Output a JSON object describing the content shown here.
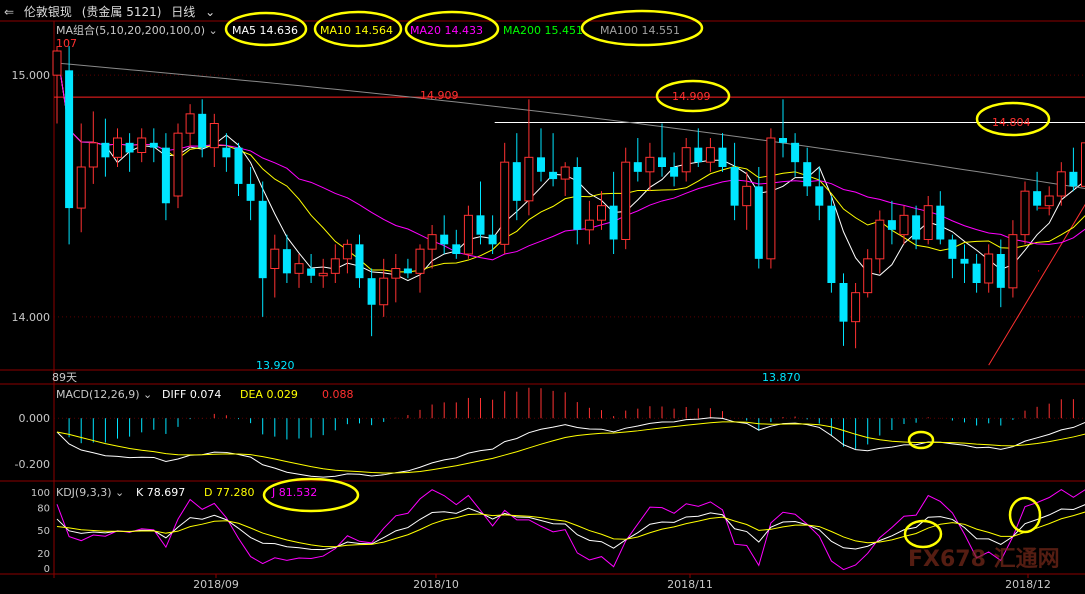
{
  "header": {
    "back_icon": "back-arrows-icon",
    "instrument": "伦敦银现",
    "market": "(贵金属 5121)",
    "period": "日线",
    "period_icon": "chevron-down-icon"
  },
  "ma_legend": {
    "label": "MA组合(5,10,20,200,100,0)",
    "items": [
      {
        "name": "MA5",
        "value": "14.636",
        "color": "#ffffff"
      },
      {
        "name": "MA10",
        "value": "14.564",
        "color": "#ffff00"
      },
      {
        "name": "MA20",
        "value": "14.433",
        "color": "#ff00ff"
      },
      {
        "name": "MA200",
        "value": "15.451",
        "color": "#00ff00"
      },
      {
        "name": "MA100",
        "value": "14.551",
        "color": "#a0a0a0"
      }
    ]
  },
  "macd_legend": {
    "label": "MACD(12,26,9)",
    "diff": "DIFF 0.074",
    "dea": "DEA 0.029",
    "macd": "0.088"
  },
  "kdj_legend": {
    "label": "KDJ(9,3,3)",
    "k": "K 78.697",
    "d": "D 77.280",
    "j": "J 81.532"
  },
  "price_panel": {
    "price_labels": [
      "15.000",
      "14.000"
    ],
    "corner_label": "107",
    "high_label": "14.909",
    "high_label_circled": "14.909",
    "recent_high_label": "14.804",
    "low_label_1": "13.920",
    "low_label_2": "13.870",
    "days_label": "89天"
  },
  "macd_axis": [
    "0.000",
    "-0.200"
  ],
  "kdj_axis": [
    "100",
    "80",
    "50",
    "20",
    "0"
  ],
  "x_axis_labels": [
    "2018/09",
    "2018/10",
    "2018/11",
    "2018/12"
  ],
  "watermark": "FX678 汇通网",
  "colors": {
    "up": "#ff3232",
    "down": "#00e5ff",
    "annotation": "#ffff00"
  },
  "chart_data": {
    "type": "candlestick",
    "x_axis": [
      "2018/09",
      "2018/10",
      "2018/11",
      "2018/12"
    ],
    "price_range": [
      13.78,
      15.22
    ],
    "candles": [
      {
        "o": 15.0,
        "h": 15.12,
        "l": 14.8,
        "c": 15.1
      },
      {
        "o": 15.02,
        "h": 15.12,
        "l": 14.3,
        "c": 14.45
      },
      {
        "o": 14.45,
        "h": 14.8,
        "l": 14.35,
        "c": 14.62
      },
      {
        "o": 14.62,
        "h": 14.85,
        "l": 14.55,
        "c": 14.72
      },
      {
        "o": 14.72,
        "h": 14.82,
        "l": 14.58,
        "c": 14.66
      },
      {
        "o": 14.66,
        "h": 14.78,
        "l": 14.62,
        "c": 14.74
      },
      {
        "o": 14.72,
        "h": 14.76,
        "l": 14.6,
        "c": 14.68
      },
      {
        "o": 14.68,
        "h": 14.78,
        "l": 14.64,
        "c": 14.74
      },
      {
        "o": 14.72,
        "h": 14.78,
        "l": 14.64,
        "c": 14.7
      },
      {
        "o": 14.7,
        "h": 14.76,
        "l": 14.4,
        "c": 14.47
      },
      {
        "o": 14.5,
        "h": 14.8,
        "l": 14.45,
        "c": 14.76
      },
      {
        "o": 14.76,
        "h": 14.88,
        "l": 14.7,
        "c": 14.84
      },
      {
        "o": 14.84,
        "h": 14.9,
        "l": 14.66,
        "c": 14.7
      },
      {
        "o": 14.7,
        "h": 14.84,
        "l": 14.62,
        "c": 14.8
      },
      {
        "o": 14.7,
        "h": 14.76,
        "l": 14.6,
        "c": 14.66
      },
      {
        "o": 14.7,
        "h": 14.72,
        "l": 14.5,
        "c": 14.55
      },
      {
        "o": 14.55,
        "h": 14.62,
        "l": 14.4,
        "c": 14.48
      },
      {
        "o": 14.48,
        "h": 14.56,
        "l": 14.0,
        "c": 14.16
      },
      {
        "o": 14.2,
        "h": 14.34,
        "l": 14.08,
        "c": 14.28
      },
      {
        "o": 14.28,
        "h": 14.34,
        "l": 14.14,
        "c": 14.18
      },
      {
        "o": 14.18,
        "h": 14.26,
        "l": 14.12,
        "c": 14.22
      },
      {
        "o": 14.2,
        "h": 14.26,
        "l": 14.14,
        "c": 14.17
      },
      {
        "o": 14.17,
        "h": 14.24,
        "l": 14.12,
        "c": 14.18
      },
      {
        "o": 14.18,
        "h": 14.3,
        "l": 14.14,
        "c": 14.24
      },
      {
        "o": 14.24,
        "h": 14.32,
        "l": 14.18,
        "c": 14.3
      },
      {
        "o": 14.3,
        "h": 14.34,
        "l": 14.12,
        "c": 14.16
      },
      {
        "o": 14.16,
        "h": 14.2,
        "l": 13.92,
        "c": 14.05
      },
      {
        "o": 14.05,
        "h": 14.24,
        "l": 14.0,
        "c": 14.16
      },
      {
        "o": 14.16,
        "h": 14.26,
        "l": 14.06,
        "c": 14.2
      },
      {
        "o": 14.2,
        "h": 14.24,
        "l": 14.16,
        "c": 14.18
      },
      {
        "o": 14.18,
        "h": 14.3,
        "l": 14.1,
        "c": 14.28
      },
      {
        "o": 14.28,
        "h": 14.38,
        "l": 14.2,
        "c": 14.34
      },
      {
        "o": 14.34,
        "h": 14.42,
        "l": 14.26,
        "c": 14.3
      },
      {
        "o": 14.3,
        "h": 14.36,
        "l": 14.24,
        "c": 14.26
      },
      {
        "o": 14.26,
        "h": 14.46,
        "l": 14.24,
        "c": 14.42
      },
      {
        "o": 14.42,
        "h": 14.56,
        "l": 14.3,
        "c": 14.34
      },
      {
        "o": 14.34,
        "h": 14.42,
        "l": 14.26,
        "c": 14.3
      },
      {
        "o": 14.3,
        "h": 14.72,
        "l": 14.26,
        "c": 14.64
      },
      {
        "o": 14.64,
        "h": 14.76,
        "l": 14.4,
        "c": 14.48
      },
      {
        "o": 14.48,
        "h": 14.9,
        "l": 14.42,
        "c": 14.66
      },
      {
        "o": 14.66,
        "h": 14.78,
        "l": 14.56,
        "c": 14.6
      },
      {
        "o": 14.6,
        "h": 14.76,
        "l": 14.54,
        "c": 14.57
      },
      {
        "o": 14.57,
        "h": 14.64,
        "l": 14.5,
        "c": 14.62
      },
      {
        "o": 14.62,
        "h": 14.66,
        "l": 14.3,
        "c": 14.36
      },
      {
        "o": 14.36,
        "h": 14.48,
        "l": 14.3,
        "c": 14.4
      },
      {
        "o": 14.4,
        "h": 14.52,
        "l": 14.36,
        "c": 14.46
      },
      {
        "o": 14.46,
        "h": 14.6,
        "l": 14.26,
        "c": 14.32
      },
      {
        "o": 14.32,
        "h": 14.7,
        "l": 14.28,
        "c": 14.64
      },
      {
        "o": 14.64,
        "h": 14.74,
        "l": 14.56,
        "c": 14.6
      },
      {
        "o": 14.6,
        "h": 14.72,
        "l": 14.52,
        "c": 14.66
      },
      {
        "o": 14.66,
        "h": 14.8,
        "l": 14.58,
        "c": 14.62
      },
      {
        "o": 14.62,
        "h": 14.68,
        "l": 14.54,
        "c": 14.58
      },
      {
        "o": 14.6,
        "h": 14.74,
        "l": 14.56,
        "c": 14.7
      },
      {
        "o": 14.7,
        "h": 14.78,
        "l": 14.62,
        "c": 14.64
      },
      {
        "o": 14.64,
        "h": 14.74,
        "l": 14.6,
        "c": 14.7
      },
      {
        "o": 14.7,
        "h": 14.76,
        "l": 14.6,
        "c": 14.62
      },
      {
        "o": 14.62,
        "h": 14.72,
        "l": 14.4,
        "c": 14.46
      },
      {
        "o": 14.46,
        "h": 14.6,
        "l": 14.36,
        "c": 14.54
      },
      {
        "o": 14.54,
        "h": 14.62,
        "l": 14.2,
        "c": 14.24
      },
      {
        "o": 14.24,
        "h": 14.78,
        "l": 14.2,
        "c": 14.74
      },
      {
        "o": 14.74,
        "h": 14.9,
        "l": 14.66,
        "c": 14.72
      },
      {
        "o": 14.72,
        "h": 14.76,
        "l": 14.58,
        "c": 14.64
      },
      {
        "o": 14.64,
        "h": 14.7,
        "l": 14.5,
        "c": 14.54
      },
      {
        "o": 14.54,
        "h": 14.62,
        "l": 14.4,
        "c": 14.46
      },
      {
        "o": 14.46,
        "h": 14.5,
        "l": 14.1,
        "c": 14.14
      },
      {
        "o": 14.14,
        "h": 14.18,
        "l": 13.88,
        "c": 13.98
      },
      {
        "o": 13.98,
        "h": 14.14,
        "l": 13.87,
        "c": 14.1
      },
      {
        "o": 14.1,
        "h": 14.28,
        "l": 14.08,
        "c": 14.24
      },
      {
        "o": 14.24,
        "h": 14.44,
        "l": 14.18,
        "c": 14.4
      },
      {
        "o": 14.4,
        "h": 14.48,
        "l": 14.3,
        "c": 14.36
      },
      {
        "o": 14.34,
        "h": 14.46,
        "l": 14.3,
        "c": 14.42
      },
      {
        "o": 14.42,
        "h": 14.46,
        "l": 14.28,
        "c": 14.32
      },
      {
        "o": 14.32,
        "h": 14.5,
        "l": 14.3,
        "c": 14.46
      },
      {
        "o": 14.46,
        "h": 14.52,
        "l": 14.3,
        "c": 14.32
      },
      {
        "o": 14.32,
        "h": 14.34,
        "l": 14.16,
        "c": 14.24
      },
      {
        "o": 14.24,
        "h": 14.3,
        "l": 14.14,
        "c": 14.22
      },
      {
        "o": 14.22,
        "h": 14.26,
        "l": 14.1,
        "c": 14.14
      },
      {
        "o": 14.14,
        "h": 14.3,
        "l": 14.1,
        "c": 14.26
      },
      {
        "o": 14.26,
        "h": 14.32,
        "l": 14.04,
        "c": 14.12
      },
      {
        "o": 14.12,
        "h": 14.4,
        "l": 14.08,
        "c": 14.34
      },
      {
        "o": 14.34,
        "h": 14.56,
        "l": 14.3,
        "c": 14.52
      },
      {
        "o": 14.52,
        "h": 14.6,
        "l": 14.44,
        "c": 14.46
      },
      {
        "o": 14.46,
        "h": 14.54,
        "l": 14.42,
        "c": 14.5
      },
      {
        "o": 14.5,
        "h": 14.64,
        "l": 14.46,
        "c": 14.6
      },
      {
        "o": 14.6,
        "h": 14.7,
        "l": 14.52,
        "c": 14.54
      },
      {
        "o": 14.54,
        "h": 14.74,
        "l": 14.5,
        "c": 14.72
      },
      {
        "o": 14.72,
        "h": 14.84,
        "l": 14.64,
        "c": 14.8
      },
      {
        "o": 14.8,
        "h": 14.82,
        "l": 14.7,
        "c": 14.75
      },
      {
        "o": 14.66,
        "h": 14.76,
        "l": 14.62,
        "c": 14.74
      }
    ],
    "horizontal_lines": [
      {
        "price": 14.909,
        "color": "#ff2020",
        "scope": "full"
      },
      {
        "price": 14.804,
        "color": "#ffffff",
        "scope": "from_bar",
        "from": 37
      },
      {
        "price": 14.45,
        "color": "#ff0000",
        "scope": "right_segment",
        "from": 82
      },
      {
        "price": 14.19,
        "color": "#ff0000",
        "scope": "right_segment",
        "from": 81
      }
    ],
    "trend_line": {
      "from_index": 77,
      "from_price": 13.8,
      "to_index": 95,
      "to_price": 15.3,
      "color": "#ff3030"
    },
    "ma200_endpoint": 15.451,
    "macd_range": [
      -0.26,
      0.14
    ],
    "kdj_range": [
      -5,
      112
    ],
    "kdj_ticks": [
      100,
      80,
      50,
      20,
      0
    ],
    "macd_ticks": [
      0.0,
      -0.2
    ],
    "annotations": [
      "MA5 14.636",
      "MA10 14.564",
      "MA20 14.433",
      "MA100 14.551",
      "14.909",
      "14.804",
      "J 81.532",
      "MACD cross",
      "KDJ cross",
      "KDJ end"
    ]
  }
}
